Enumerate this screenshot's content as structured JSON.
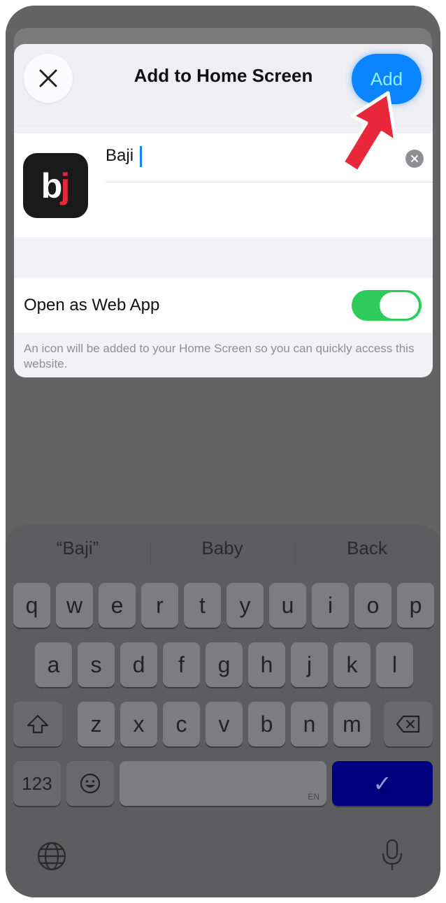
{
  "header": {
    "title": "Add to Home Screen",
    "add_label": "Add"
  },
  "app": {
    "icon_text_b": "b",
    "icon_text_j": "j",
    "name_value": "Baji"
  },
  "web_app": {
    "label": "Open as Web App",
    "enabled": true
  },
  "footnote": "An icon will be added to your Home Screen so you can quickly access this website.",
  "keyboard": {
    "suggestions": [
      "“Baji”",
      "Baby",
      "Back"
    ],
    "row1": [
      "q",
      "w",
      "e",
      "r",
      "t",
      "y",
      "u",
      "i",
      "o",
      "p"
    ],
    "row2": [
      "a",
      "s",
      "d",
      "f",
      "g",
      "h",
      "j",
      "k",
      "l"
    ],
    "row3": [
      "z",
      "x",
      "c",
      "v",
      "b",
      "n",
      "m"
    ],
    "numbers_label": "123",
    "space_lang": "EN",
    "done_symbol": "✓"
  },
  "colors": {
    "accent": "#0a84ff",
    "toggle_on": "#2ecc5a",
    "arrow": "#e8283a",
    "done_key": "#00007f"
  }
}
